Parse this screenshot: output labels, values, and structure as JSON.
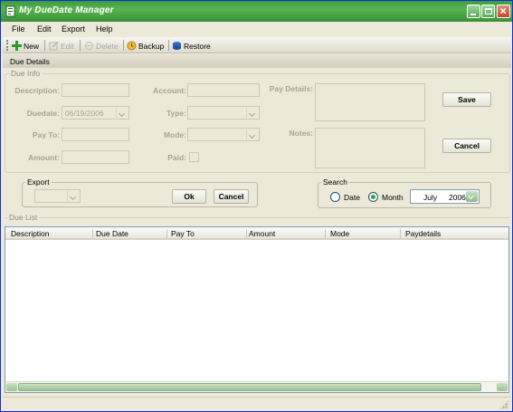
{
  "window": {
    "title": "My DueDate  Manager"
  },
  "menu": [
    "File",
    "Edit",
    "Export",
    "Help"
  ],
  "toolbar": {
    "new": "New",
    "edit": "Edit",
    "delete": "Delete",
    "backup": "Backup",
    "restore": "Restore"
  },
  "tab": {
    "label": "Due Details"
  },
  "due_info": {
    "legend": "Due Info",
    "description_label": "Description:",
    "account_label": "Account:",
    "pay_details_label": "Pay Details:",
    "duedate_label": "Duedate:",
    "duedate_value": "06/19/2006",
    "type_label": "Type:",
    "pay_to_label": "Pay To:",
    "mode_label": "Mode:",
    "notes_label": "Notes:",
    "amount_label": "Amount:",
    "paid_label": "Paid:",
    "save_button": "Save",
    "cancel_button": "Cancel"
  },
  "export": {
    "legend": "Export",
    "ok_button": "Ok",
    "cancel_button": "Cancel"
  },
  "search": {
    "legend": "Search",
    "date_label": "Date",
    "month_label": "Month",
    "selected": "Month",
    "month_value": "July",
    "year_value": "2006"
  },
  "due_list": {
    "legend": "Due List",
    "columns": [
      "Description",
      "Due Date",
      "Pay To",
      "Amount",
      "Mode",
      "Paydetails"
    ]
  },
  "colors": {
    "title_bar": "#57b64f",
    "window_bg": "#ece9d8",
    "list_border": "#7f9db9"
  },
  "icons": [
    "app-icon",
    "new-icon",
    "edit-icon",
    "delete-icon",
    "backup-icon",
    "restore-icon",
    "minimize-icon",
    "maximize-icon",
    "close-icon",
    "chevron-down-icon"
  ]
}
